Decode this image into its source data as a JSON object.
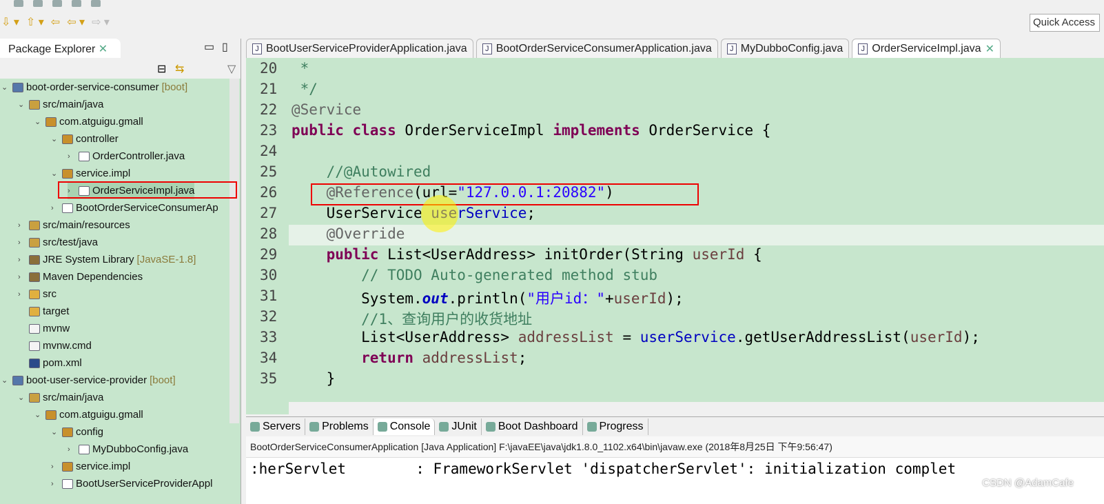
{
  "toolbar": {
    "quick_access": "Quick Access"
  },
  "package_explorer": {
    "title": "Package Explorer",
    "items": [
      {
        "label": "boot-order-service-consumer",
        "deco": " [boot]",
        "level": 0,
        "expanded": true,
        "icon": "maven-project-icon"
      },
      {
        "label": "src/main/java",
        "level": 1,
        "expanded": true,
        "icon": "source-folder-icon"
      },
      {
        "label": "com.atguigu.gmall",
        "level": 2,
        "expanded": true,
        "icon": "package-icon"
      },
      {
        "label": "controller",
        "level": 3,
        "expanded": true,
        "icon": "package-icon"
      },
      {
        "label": "OrderController.java",
        "level": 4,
        "expanded": false,
        "icon": "java-file-icon"
      },
      {
        "label": "service.impl",
        "level": 3,
        "expanded": true,
        "icon": "package-icon"
      },
      {
        "label": "OrderServiceImpl.java",
        "level": 4,
        "expanded": false,
        "icon": "java-file-icon",
        "selected": true
      },
      {
        "label": "BootOrderServiceConsumerAp",
        "level": 3,
        "expanded": false,
        "icon": "java-file-icon"
      },
      {
        "label": "src/main/resources",
        "level": 1,
        "expanded": false,
        "icon": "source-folder-icon"
      },
      {
        "label": "src/test/java",
        "level": 1,
        "expanded": false,
        "icon": "source-folder-icon"
      },
      {
        "label": "JRE System Library",
        "deco": " [JavaSE-1.8]",
        "level": 1,
        "expanded": false,
        "icon": "library-icon"
      },
      {
        "label": "Maven Dependencies",
        "level": 1,
        "expanded": false,
        "icon": "library-icon"
      },
      {
        "label": "src",
        "level": 1,
        "expanded": false,
        "icon": "folder-icon"
      },
      {
        "label": "target",
        "level": 1,
        "expanded": null,
        "icon": "folder-icon"
      },
      {
        "label": "mvnw",
        "level": 1,
        "expanded": null,
        "icon": "file-icon"
      },
      {
        "label": "mvnw.cmd",
        "level": 1,
        "expanded": null,
        "icon": "file-icon"
      },
      {
        "label": "pom.xml",
        "level": 1,
        "expanded": null,
        "icon": "maven-file-icon"
      },
      {
        "label": "boot-user-service-provider",
        "deco": " [boot]",
        "level": 0,
        "expanded": true,
        "icon": "maven-project-icon"
      },
      {
        "label": "src/main/java",
        "level": 1,
        "expanded": true,
        "icon": "source-folder-icon"
      },
      {
        "label": "com.atguigu.gmall",
        "level": 2,
        "expanded": true,
        "icon": "package-icon"
      },
      {
        "label": "config",
        "level": 3,
        "expanded": true,
        "icon": "package-icon"
      },
      {
        "label": "MyDubboConfig.java",
        "level": 4,
        "expanded": false,
        "icon": "java-file-icon"
      },
      {
        "label": "service.impl",
        "level": 3,
        "expanded": false,
        "icon": "package-icon"
      },
      {
        "label": "BootUserServiceProviderAppl",
        "level": 3,
        "expanded": false,
        "icon": "java-file-icon"
      }
    ]
  },
  "editor": {
    "tabs": [
      {
        "label": "BootUserServiceProviderApplication.java",
        "active": false
      },
      {
        "label": "BootOrderServiceConsumerApplication.java",
        "active": false
      },
      {
        "label": "MyDubboConfig.java",
        "active": false
      },
      {
        "label": "OrderServiceImpl.java",
        "active": true
      }
    ],
    "lines": [
      {
        "n": "20",
        "tokens": [
          [
            "cm",
            " *"
          ]
        ]
      },
      {
        "n": "21",
        "tokens": [
          [
            "cm",
            " */"
          ]
        ]
      },
      {
        "n": "22",
        "tokens": [
          [
            "an",
            "@Service"
          ]
        ]
      },
      {
        "n": "23",
        "tokens": [
          [
            "kw",
            "public class "
          ],
          [
            "",
            "OrderServiceImpl "
          ],
          [
            "kw",
            "implements "
          ],
          [
            "",
            "OrderService {"
          ]
        ]
      },
      {
        "n": "24",
        "tokens": []
      },
      {
        "n": "25",
        "tokens": [
          [
            "cm",
            "    //@Autowired"
          ]
        ]
      },
      {
        "n": "26",
        "tokens": [
          [
            "an",
            "    @Reference"
          ],
          [
            "",
            "(url="
          ],
          [
            "st",
            "\"127.0.0.1:20882\""
          ],
          [
            "",
            ")"
          ]
        ]
      },
      {
        "n": "27",
        "tokens": [
          [
            "",
            "    UserService "
          ],
          [
            "fd",
            "userService"
          ],
          [
            "",
            ";"
          ]
        ]
      },
      {
        "n": "28",
        "tokens": [
          [
            "an",
            "    @Override"
          ]
        ]
      },
      {
        "n": "29",
        "tokens": [
          [
            "kw",
            "    public "
          ],
          [
            "",
            "List<UserAddress> initOrder(String "
          ],
          [
            "pv",
            "userId"
          ],
          [
            "",
            " {"
          ]
        ]
      },
      {
        "n": "30",
        "tokens": [
          [
            "cm",
            "        // "
          ],
          [
            "cm",
            "TODO"
          ],
          [
            "cm",
            " Auto-generated method stub"
          ]
        ]
      },
      {
        "n": "31",
        "tokens": [
          [
            "",
            "        System."
          ],
          [
            "fi",
            "out"
          ],
          [
            "",
            ".println("
          ],
          [
            "st",
            "\"用户id：\""
          ],
          [
            "",
            "+"
          ],
          [
            "pv",
            "userId"
          ],
          [
            "",
            ");"
          ]
        ]
      },
      {
        "n": "32",
        "tokens": [
          [
            "cm",
            "        //1、查询用户的收货地址"
          ]
        ]
      },
      {
        "n": "33",
        "tokens": [
          [
            "",
            "        List<UserAddress> "
          ],
          [
            "pv",
            "addressList"
          ],
          [
            "",
            " = "
          ],
          [
            "fd",
            "userService"
          ],
          [
            "",
            ".getUserAddressList("
          ],
          [
            "pv",
            "userId"
          ],
          [
            "",
            ");"
          ]
        ]
      },
      {
        "n": "34",
        "tokens": [
          [
            "kw",
            "        return "
          ],
          [
            "pv",
            "addressList"
          ],
          [
            "",
            ";"
          ]
        ]
      },
      {
        "n": "35",
        "tokens": [
          [
            "",
            "    }"
          ]
        ]
      }
    ]
  },
  "console": {
    "tabs": [
      {
        "label": "Servers",
        "icon": "servers-icon"
      },
      {
        "label": "Problems",
        "icon": "problems-icon"
      },
      {
        "label": "Console",
        "icon": "console-icon",
        "active": true
      },
      {
        "label": "JUnit",
        "icon": "junit-icon"
      },
      {
        "label": "Boot Dashboard",
        "icon": "boot-dashboard-icon"
      },
      {
        "label": "Progress",
        "icon": "progress-icon"
      }
    ],
    "description": "BootOrderServiceConsumerApplication [Java Application] F:\\javaEE\\java\\jdk1.8.0_1102.x64\\bin\\javaw.exe (2018年8月25日 下午9:56:47)",
    "output": ":herServlet        : FrameworkServlet 'dispatcherServlet': initialization complet"
  },
  "watermark": "CSDN @AdamCafe",
  "colors": {
    "editor_bg": "#c7e6cd",
    "highlight_box": "#e00000"
  }
}
